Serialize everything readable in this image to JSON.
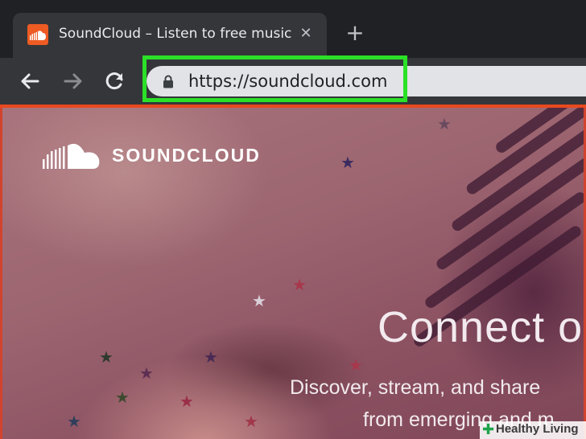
{
  "browser": {
    "tab": {
      "title": "SoundCloud – Listen to free music",
      "favicon": "soundcloud-icon",
      "close_glyph": "✕"
    },
    "new_tab_glyph": "+",
    "toolbar": {
      "back_icon": "arrow-left-icon",
      "forward_icon": "arrow-right-icon",
      "reload_icon": "reload-icon"
    },
    "address_bar": {
      "url": "https://soundcloud.com",
      "lock_icon": "lock-icon"
    },
    "highlight_color": "#2be127"
  },
  "page": {
    "logo_text": "SOUNDCLOUD",
    "hero": {
      "title": "Connect o",
      "subtitle_line1": "Discover, stream, and share",
      "subtitle_line2": "from emerging and m"
    }
  },
  "watermark": {
    "text": "Healthy Living"
  },
  "colors": {
    "accent": "#e8491f",
    "tabbar": "#202124",
    "toolbar": "#35363a",
    "frame": "#d2432d"
  }
}
